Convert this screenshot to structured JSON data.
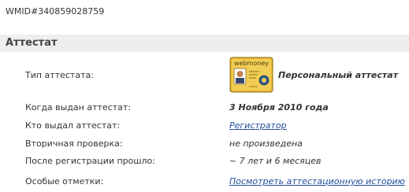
{
  "wmid": "WMID#340859028759",
  "section": {
    "title": "Аттестат"
  },
  "rows": {
    "type": {
      "label": "Тип аттестата:",
      "value": "Персональный аттестат",
      "icon": "webmoney-certificate-icon",
      "icon_text": "webmoney"
    },
    "issued_date": {
      "label": "Когда выдан аттестат:",
      "value": "3 Ноября 2010 года"
    },
    "issuer": {
      "label": "Кто выдал аттестат:",
      "value": "Регистратор"
    },
    "secondary_check": {
      "label": "Вторичная проверка:",
      "value": "не произведена"
    },
    "since_registration": {
      "label": "После регистрации прошло:",
      "value": "~ 7 лет и 6 месяцев"
    },
    "special_marks": {
      "label": "Особые отметки:",
      "value": "Посмотреть аттестационную историю"
    }
  },
  "colors": {
    "link": "#1f4f9a",
    "header_bg": "#eeeeee",
    "cert_gold": "#e8b830"
  }
}
